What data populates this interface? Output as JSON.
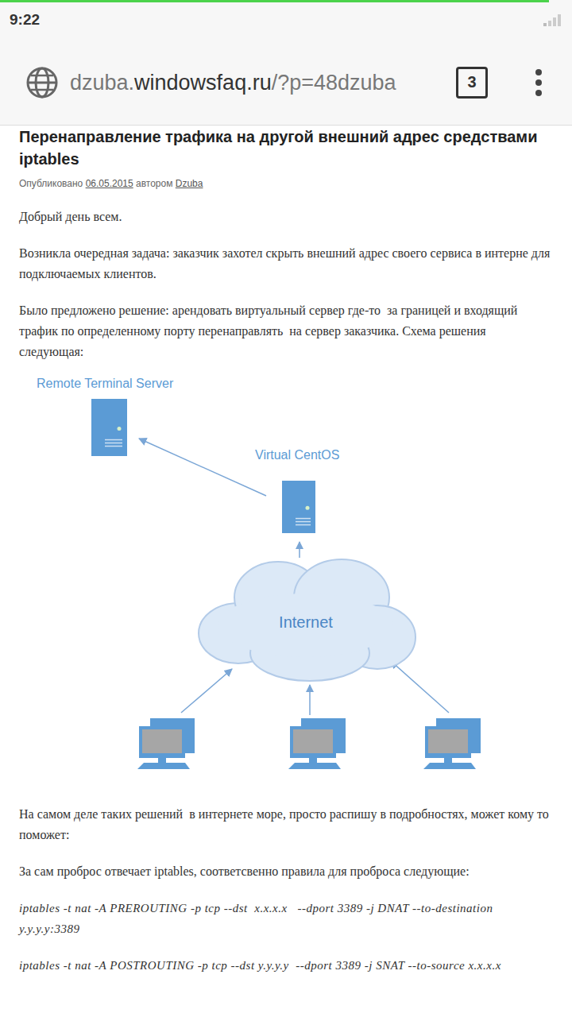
{
  "status_bar": {
    "time": "9:22"
  },
  "page_load": {
    "level": 0.96
  },
  "address_bar": {
    "url_prefix": "dzuba.",
    "url_host": "windowsfaq.ru",
    "url_path": "/?p=48dzuba",
    "tab_count": "3"
  },
  "article": {
    "title": "Перенаправление трафика на другой внешний адрес средствами iptables",
    "meta": {
      "published_label": "Опубликовано",
      "date": "06.05.2015",
      "by_label": "автором",
      "author": "Dzuba"
    },
    "paragraphs_before": [
      "Добрый день всем.",
      "Возникла очередная задача: заказчик захотел скрыть внешний адрес своего сервиса в интерне для подключаемых клиентов.",
      "Было предложено решение: арендовать виртуальный сервер где-то  за границей и входящий трафик по определенному порту перенаправлять  на сервер заказчика. Схема решения следующая:"
    ],
    "diagram": {
      "servers": [
        {
          "label": "Remote Terminal Server"
        },
        {
          "label": "Virtual CentOS"
        }
      ],
      "cloud": {
        "label": "Internet"
      },
      "client_count": 3
    },
    "paragraphs_after": [
      "На самом деле таких решений  в интернете море, просто распишу в подробностях, может кому то поможет:",
      "За сам проброс отвечает iptables, соответсвенно правила для проброса следующие:"
    ],
    "commands": [
      "iptables -t nat -A PREROUTING -p tcp --dst  x.x.x.x   --dport 3389 -j DNAT --to-destination y.y.y.y:3389",
      "iptables -t nat -A POSTROUTING -p tcp --dst y.y.y.y  --dport 3389 -j SNAT --to-source x.x.x.x"
    ]
  }
}
